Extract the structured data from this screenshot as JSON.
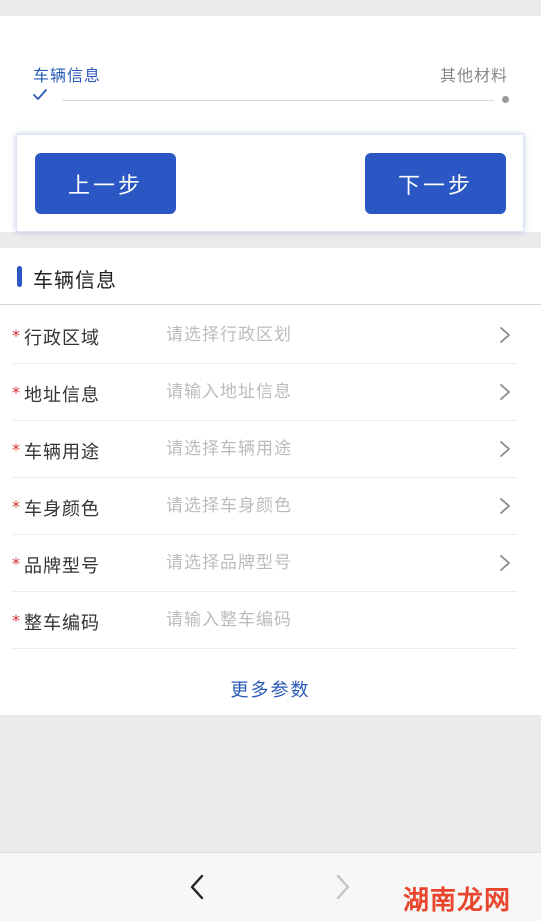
{
  "steps": {
    "current": "车辆信息",
    "next": "其他材料"
  },
  "buttons": {
    "prev": "上一步",
    "next": "下一步"
  },
  "section": {
    "title": "车辆信息"
  },
  "form": {
    "required_mark": "*",
    "rows": [
      {
        "label": "行政区域",
        "placeholder": "请选择行政区划",
        "value": "",
        "has_chevron": true
      },
      {
        "label": "地址信息",
        "placeholder": "请输入地址信息",
        "value": "",
        "has_chevron": true
      },
      {
        "label": "车辆用途",
        "placeholder": "请选择车辆用途",
        "value": "",
        "has_chevron": true
      },
      {
        "label": "车身颜色",
        "placeholder": "请选择车身颜色",
        "value": "",
        "has_chevron": true
      },
      {
        "label": "品牌型号",
        "placeholder": "请选择品牌型号",
        "value": "",
        "has_chevron": true
      },
      {
        "label": "整车编码",
        "placeholder": "请输入整车编码",
        "value": "",
        "has_chevron": false
      }
    ],
    "more_link": "更多参数"
  },
  "watermark": {
    "text_cn": "湖南",
    "text_mid": "龙",
    "text_en": "网"
  },
  "colors": {
    "accent": "#2a57c4",
    "link": "#2a5ab8",
    "required": "#d32f2f",
    "placeholder": "#bcbcbc"
  }
}
